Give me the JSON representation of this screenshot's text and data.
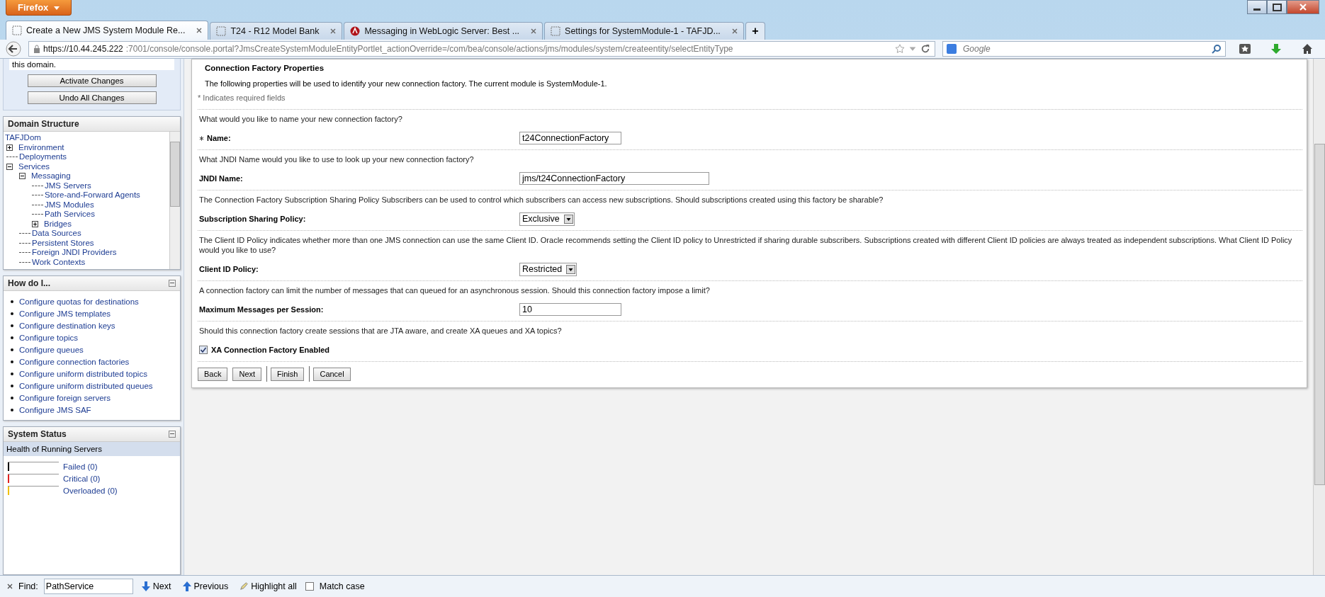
{
  "browser": {
    "menu_button": "Firefox",
    "tabs": [
      {
        "title": "Create a New JMS System Module Re...",
        "selected": true,
        "kind": "page"
      },
      {
        "title": "T24 - R12 Model Bank",
        "selected": false,
        "kind": "page"
      },
      {
        "title": "Messaging in WebLogic Server: Best ...",
        "selected": false,
        "kind": "logo"
      },
      {
        "title": "Settings for SystemModule-1 - TAFJD...",
        "selected": false,
        "kind": "page"
      }
    ],
    "new_tab": "+",
    "url_host": "https://10.44.245.222",
    "url_rest": ":7001/console/console.portal?JmsCreateSystemModuleEntityPortlet_actionOverride=/com/bea/console/actions/jms/modules/system/createentity/selectEntityType",
    "search_placeholder": "Google"
  },
  "change_center": {
    "text": "this domain.",
    "buttons": [
      "Activate Changes",
      "Undo All Changes"
    ]
  },
  "domain_structure": {
    "title": "Domain Structure",
    "root": "TAFJDom",
    "items": [
      {
        "label": "Environment",
        "expanded": false
      },
      {
        "label": "Deployments"
      },
      {
        "label": "Services",
        "expanded": true,
        "children": [
          {
            "label": "Messaging",
            "expanded": true,
            "children": [
              {
                "label": "JMS Servers"
              },
              {
                "label": "Store-and-Forward Agents"
              },
              {
                "label": "JMS Modules"
              },
              {
                "label": "Path Services"
              },
              {
                "label": "Bridges",
                "expanded": false
              }
            ]
          },
          {
            "label": "Data Sources"
          },
          {
            "label": "Persistent Stores"
          },
          {
            "label": "Foreign JNDI Providers"
          },
          {
            "label": "Work Contexts"
          }
        ]
      }
    ]
  },
  "how_do_i": {
    "title": "How do I...",
    "links": [
      "Configure quotas for destinations",
      "Configure JMS templates",
      "Configure destination keys",
      "Configure topics",
      "Configure queues",
      "Configure connection factories",
      "Configure uniform distributed topics",
      "Configure uniform distributed queues",
      "Configure foreign servers",
      "Configure JMS SAF"
    ]
  },
  "system_status": {
    "title": "System Status",
    "subtitle": "Health of Running Servers",
    "rows": [
      {
        "label": "Failed (0)",
        "color": "#000000"
      },
      {
        "label": "Critical (0)",
        "color": "#e02020"
      },
      {
        "label": "Overloaded (0)",
        "color": "#f0c000"
      }
    ]
  },
  "form": {
    "title": "Connection Factory Properties",
    "intro": "The following properties will be used to identify your new connection factory. The current module is SystemModule-1.",
    "required_note": "* Indicates required fields",
    "fields": [
      {
        "kind": "text",
        "question": "What would you like to name your new connection factory?",
        "label": "Name:",
        "required": true,
        "value": "t24ConnectionFactory",
        "wide": false
      },
      {
        "kind": "text",
        "question": "What JNDI Name would you like to use to look up your new connection factory?",
        "label": "JNDI Name:",
        "required": false,
        "value": "jms/t24ConnectionFactory",
        "wide": true
      },
      {
        "kind": "select",
        "question": "The Connection Factory Subscription Sharing Policy Subscribers can be used to control which subscribers can access new subscriptions. Should subscriptions created using this factory be sharable?",
        "label": "Subscription Sharing Policy:",
        "required": false,
        "value": "Exclusive"
      },
      {
        "kind": "select",
        "question": "The Client ID Policy indicates whether more than one JMS connection can use the same Client ID. Oracle recommends setting the Client ID policy to Unrestricted if sharing durable subscribers. Subscriptions created with different Client ID policies are always treated as independent subscriptions. What Client ID Policy would you like to use?",
        "label": "Client ID Policy:",
        "required": false,
        "value": "Restricted"
      },
      {
        "kind": "text",
        "question": "A connection factory can limit the number of messages that can queued for an asynchronous session. Should this connection factory impose a limit?",
        "label": "Maximum Messages per Session:",
        "required": false,
        "value": "10",
        "wide": false
      },
      {
        "kind": "checkbox",
        "question": "Should this connection factory create sessions that are JTA aware, and create XA queues and XA topics?",
        "label": "XA Connection Factory Enabled",
        "checked": true
      }
    ],
    "buttons": [
      "Back",
      "Next",
      "Finish",
      "Cancel"
    ]
  },
  "find_bar": {
    "label": "Find:",
    "value": "PathService",
    "next": "Next",
    "previous": "Previous",
    "highlight": "Highlight all",
    "match_case": "Match case",
    "match_case_checked": false
  }
}
